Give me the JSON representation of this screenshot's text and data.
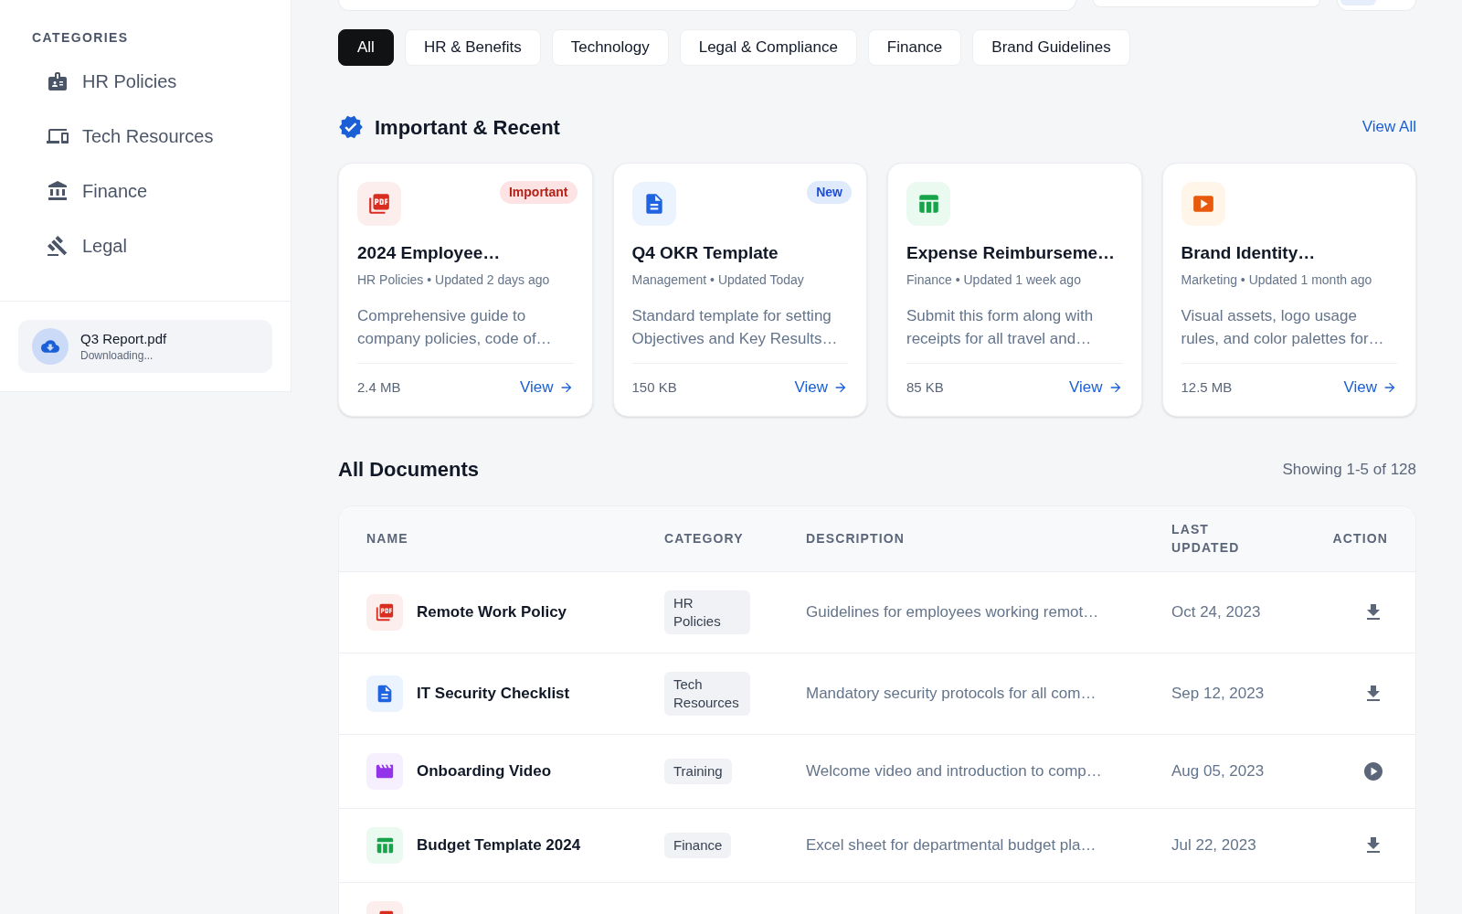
{
  "sidebar": {
    "heading": "CATEGORIES",
    "items": [
      {
        "label": "HR Policies",
        "selected": false
      },
      {
        "label": "Tech Resources",
        "selected": false
      },
      {
        "label": "Finance",
        "selected": false
      },
      {
        "label": "Legal",
        "selected": false
      }
    ],
    "download": {
      "file": "Q3 Report.pdf",
      "status": "Downloading..."
    }
  },
  "filters": [
    {
      "label": "All",
      "selected": true
    },
    {
      "label": "HR & Benefits",
      "selected": false
    },
    {
      "label": "Technology",
      "selected": false
    },
    {
      "label": "Legal & Compliance",
      "selected": false
    },
    {
      "label": "Finance",
      "selected": false
    },
    {
      "label": "Brand Guidelines",
      "selected": false
    }
  ],
  "important": {
    "title": "Important & Recent",
    "link": "View All",
    "cards": [
      {
        "kind": "pdf",
        "badge": {
          "label": "Important",
          "kind": "important"
        },
        "title": "2024 Employee…",
        "meta": "HR Policies • Updated 2 days ago",
        "description": "Comprehensive guide to company policies, code of…",
        "size": "2.4 MB",
        "link": "View"
      },
      {
        "kind": "doc",
        "badge": {
          "label": "New",
          "kind": "new"
        },
        "title": "Q4 OKR Template",
        "meta": "Management • Updated Today",
        "description": "Standard template for setting Objectives and Key Results…",
        "size": "150 KB",
        "link": "View"
      },
      {
        "kind": "sheet",
        "title": "Expense Reimburseme…",
        "meta": "Finance • Updated 1 week ago",
        "description": "Submit this form along with receipts for all travel and…",
        "size": "85 KB",
        "link": "View"
      },
      {
        "kind": "slides",
        "title": "Brand Identity…",
        "meta": "Marketing • Updated 1 month ago",
        "description": "Visual assets, logo usage rules, and color palettes for…",
        "size": "12.5 MB",
        "link": "View"
      }
    ]
  },
  "documents": {
    "title": "All Documents",
    "summary": "Showing 1-5 of 128",
    "columns": [
      "NAME",
      "CATEGORY",
      "DESCRIPTION",
      "LAST UPDATED",
      "ACTION"
    ],
    "rows": [
      {
        "kind": "pdf",
        "name": "Remote Work Policy",
        "category": "HR Policies",
        "description": "Guidelines for employees working remot…",
        "updated": "Oct 24, 2023",
        "action": {
          "kind": "download"
        }
      },
      {
        "kind": "doc",
        "name": "IT Security Checklist",
        "category": "Tech Resources",
        "description": "Mandatory security protocols for all com…",
        "updated": "Sep 12, 2023",
        "action": {
          "kind": "download"
        }
      },
      {
        "kind": "video",
        "name": "Onboarding Video",
        "category": "Training",
        "description": "Welcome video and introduction to comp…",
        "updated": "Aug 05, 2023",
        "action": {
          "kind": "play"
        }
      },
      {
        "kind": "sheet",
        "name": "Budget Template 2024",
        "category": "Finance",
        "description": "Excel sheet for departmental budget pla…",
        "updated": "Jul 22, 2023",
        "action": {
          "kind": "download"
        }
      },
      {
        "kind": "pdf"
      }
    ]
  }
}
